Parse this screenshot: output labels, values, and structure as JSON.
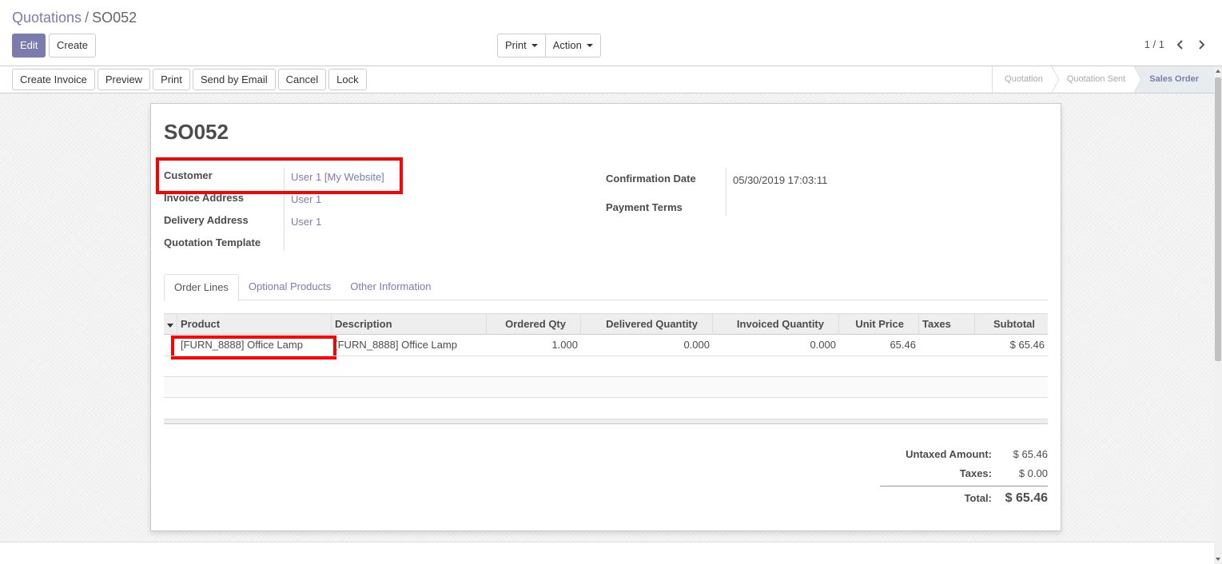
{
  "breadcrumb": {
    "parent": "Quotations",
    "separator": "/",
    "current": "SO052"
  },
  "toolbar": {
    "edit_label": "Edit",
    "create_label": "Create",
    "print_label": "Print",
    "action_label": "Action"
  },
  "pager": {
    "value": "1 / 1"
  },
  "status_buttons": [
    "Create Invoice",
    "Preview",
    "Print",
    "Send by Email",
    "Cancel",
    "Lock"
  ],
  "stages": [
    {
      "label": "Quotation",
      "active": false
    },
    {
      "label": "Quotation Sent",
      "active": false
    },
    {
      "label": "Sales Order",
      "active": true
    }
  ],
  "form": {
    "title": "SO052",
    "left_fields": [
      {
        "label": "Customer",
        "value": "User 1 [My Website]"
      },
      {
        "label": "Invoice Address",
        "value": "User 1"
      },
      {
        "label": "Delivery Address",
        "value": "User 1"
      },
      {
        "label": "Quotation Template",
        "value": ""
      }
    ],
    "right_fields": [
      {
        "label": "Confirmation Date",
        "value": "05/30/2019 17:03:11"
      },
      {
        "label": "Payment Terms",
        "value": ""
      }
    ]
  },
  "tabs": [
    "Order Lines",
    "Optional Products",
    "Other Information"
  ],
  "table": {
    "columns": [
      "Product",
      "Description",
      "Ordered Qty",
      "Delivered Quantity",
      "Invoiced Quantity",
      "Unit Price",
      "Taxes",
      "Subtotal"
    ],
    "rows": [
      [
        "[FURN_8888] Office Lamp",
        "[FURN_8888] Office Lamp",
        "1.000",
        "0.000",
        "0.000",
        "65.46",
        "",
        "$ 65.46"
      ]
    ]
  },
  "totals": {
    "untaxed_label": "Untaxed Amount:",
    "untaxed_value": "$ 65.46",
    "taxes_label": "Taxes:",
    "taxes_value": "$ 0.00",
    "total_label": "Total:",
    "total_value": "$ 65.46"
  },
  "colors": {
    "accent": "#7c7bad",
    "highlight": "#ff0000"
  }
}
